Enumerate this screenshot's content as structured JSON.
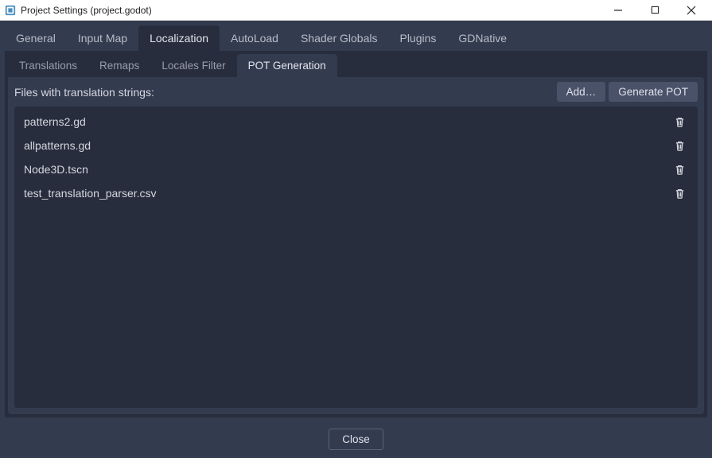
{
  "window": {
    "title": "Project Settings (project.godot)"
  },
  "primary_tabs": [
    {
      "label": "General"
    },
    {
      "label": "Input Map"
    },
    {
      "label": "Localization",
      "active": true
    },
    {
      "label": "AutoLoad"
    },
    {
      "label": "Shader Globals"
    },
    {
      "label": "Plugins"
    },
    {
      "label": "GDNative"
    }
  ],
  "secondary_tabs": [
    {
      "label": "Translations"
    },
    {
      "label": "Remaps"
    },
    {
      "label": "Locales Filter"
    },
    {
      "label": "POT Generation",
      "active": true
    }
  ],
  "toolbar": {
    "label": "Files with translation strings:",
    "add_label": "Add…",
    "generate_label": "Generate POT"
  },
  "files": [
    {
      "name": "patterns2.gd"
    },
    {
      "name": "allpatterns.gd"
    },
    {
      "name": "Node3D.tscn"
    },
    {
      "name": "test_translation_parser.csv"
    }
  ],
  "footer": {
    "close_label": "Close"
  }
}
